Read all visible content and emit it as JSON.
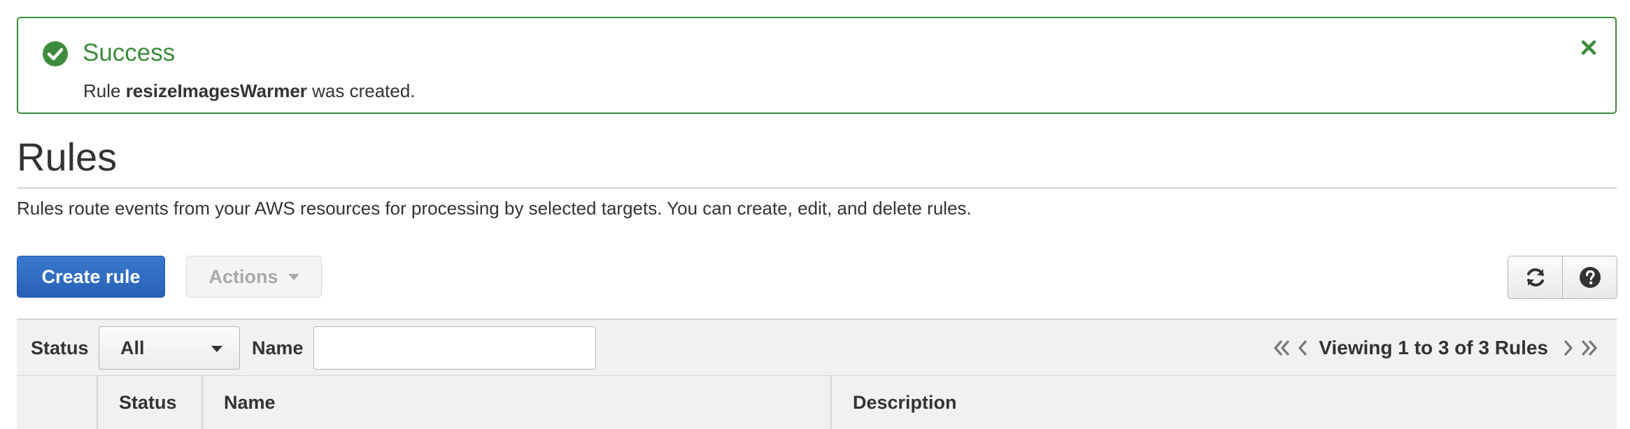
{
  "alert": {
    "title": "Success",
    "message_prefix": "Rule",
    "rule_name": "resizeImagesWarmer",
    "message_suffix": "was created.",
    "color": "#3d8b3d"
  },
  "header": {
    "title": "Rules",
    "description": "Rules route events from your AWS resources for processing by selected targets. You can create, edit, and delete rules."
  },
  "toolbar": {
    "create_label": "Create rule",
    "actions_label": "Actions",
    "refresh_icon": "refresh-icon",
    "help_icon": "help-icon",
    "primary_color": "#2d6cc0"
  },
  "filters": {
    "status_label": "Status",
    "status_value": "All",
    "name_label": "Name",
    "name_value": "",
    "name_placeholder": ""
  },
  "pagination": {
    "text": "Viewing 1 to 3 of 3 Rules"
  },
  "table": {
    "columns": [
      "Status",
      "Name",
      "Description"
    ]
  }
}
